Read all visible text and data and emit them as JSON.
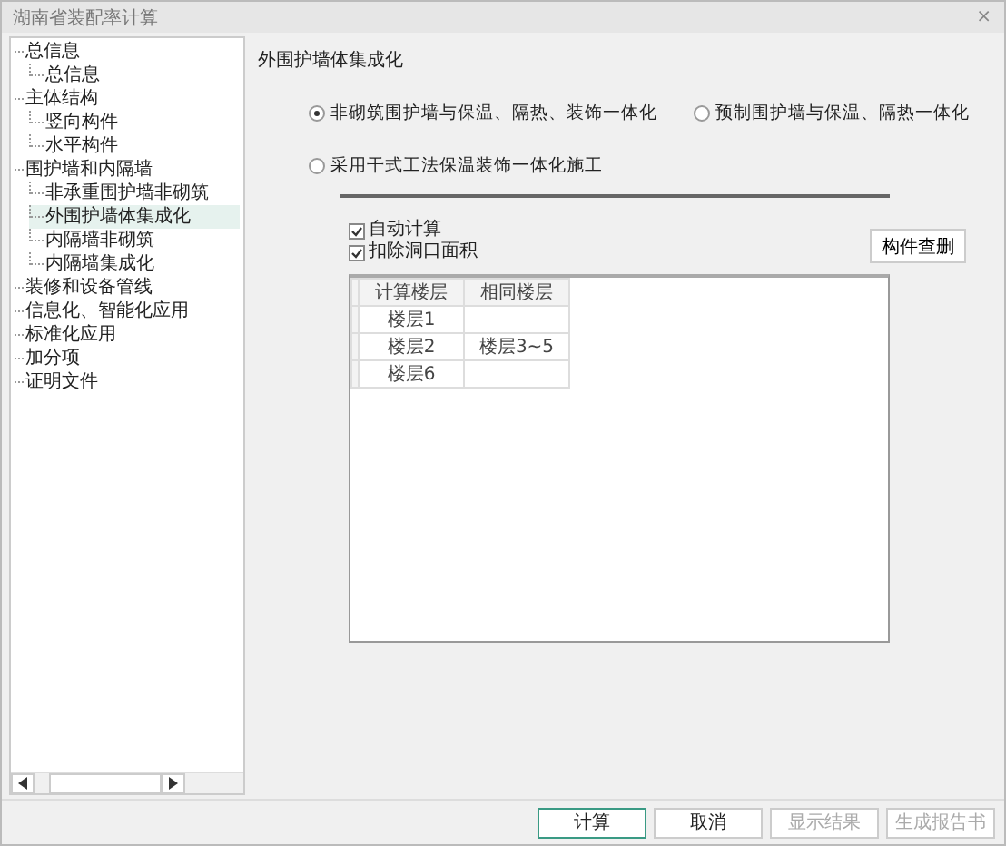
{
  "window": {
    "title": "湖南省装配率计算",
    "close": "×"
  },
  "sidebar": {
    "items": [
      {
        "label": "总信息",
        "selected": false,
        "children": [
          {
            "label": "总信息",
            "selected": false
          }
        ]
      },
      {
        "label": "主体结构",
        "selected": false,
        "children": [
          {
            "label": "竖向构件",
            "selected": false
          },
          {
            "label": "水平构件",
            "selected": false
          }
        ]
      },
      {
        "label": "围护墙和内隔墙",
        "selected": false,
        "children": [
          {
            "label": "非承重围护墙非砌筑",
            "selected": false
          },
          {
            "label": "外围护墙体集成化",
            "selected": true
          },
          {
            "label": "内隔墙非砌筑",
            "selected": false
          },
          {
            "label": "内隔墙集成化",
            "selected": false
          }
        ]
      },
      {
        "label": "装修和设备管线",
        "selected": false
      },
      {
        "label": "信息化、智能化应用",
        "selected": false
      },
      {
        "label": "标准化应用",
        "selected": false
      },
      {
        "label": "加分项",
        "selected": false
      },
      {
        "label": "证明文件",
        "selected": false
      }
    ]
  },
  "panel": {
    "title": "外围护墙体集成化",
    "options": [
      {
        "label": "非砌筑围护墙与保温、隔热、装饰一体化",
        "selected": true
      },
      {
        "label": "预制围护墙与保温、隔热一体化",
        "selected": false
      },
      {
        "label": "采用干式工法保温装饰一体化施工",
        "selected": false
      }
    ],
    "checkboxes": [
      {
        "label": "自动计算",
        "checked": true
      },
      {
        "label": "扣除洞口面积",
        "checked": true
      }
    ],
    "action_button": "构件查删",
    "table": {
      "columns": [
        "计算楼层",
        "相同楼层"
      ],
      "rows": [
        [
          "楼层1",
          ""
        ],
        [
          "楼层2",
          "楼层3~5"
        ],
        [
          "楼层6",
          ""
        ]
      ]
    }
  },
  "buttons": [
    {
      "label": "计算",
      "disabled": false,
      "default": true
    },
    {
      "label": "取消",
      "disabled": false,
      "default": false
    },
    {
      "label": "显示结果",
      "disabled": true,
      "default": false
    },
    {
      "label": "生成报告书",
      "disabled": true,
      "default": false
    }
  ]
}
